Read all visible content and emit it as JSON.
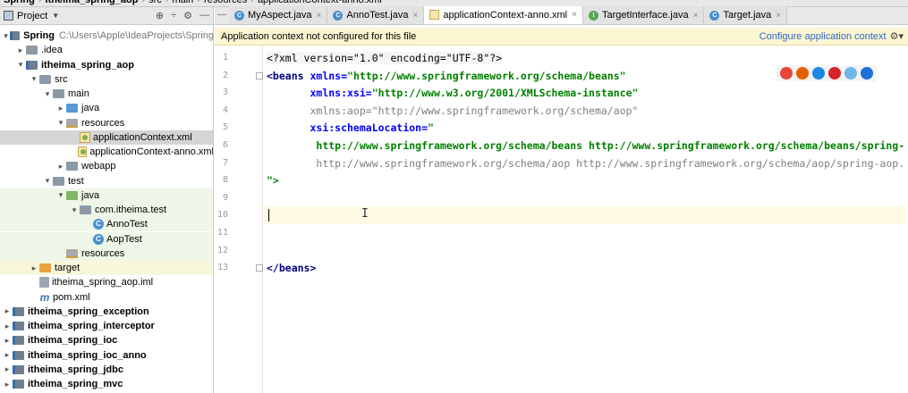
{
  "breadcrumb": [
    "Spring",
    "itheima_spring_aop",
    "src",
    "main",
    "resources",
    "applicationContext-anno.xml"
  ],
  "project_panel": {
    "title": "Project",
    "tools": [
      "⊕",
      "÷",
      "⚙",
      "—"
    ],
    "rows": [
      {
        "indent": 0,
        "arrow": "▾",
        "icon": "module",
        "label": "Spring",
        "bold": true,
        "hint": "C:\\Users\\Apple\\IdeaProjects\\Spring"
      },
      {
        "indent": 1,
        "arrow": "▸",
        "icon": "folder",
        "label": ".idea"
      },
      {
        "indent": 1,
        "arrow": "▾",
        "icon": "module",
        "label": "itheima_spring_aop",
        "bold": true
      },
      {
        "indent": 2,
        "arrow": "▾",
        "icon": "folder",
        "label": "src"
      },
      {
        "indent": 3,
        "arrow": "▾",
        "icon": "folder",
        "label": "main"
      },
      {
        "indent": 4,
        "arrow": "▸",
        "icon": "folder-blue",
        "label": "java"
      },
      {
        "indent": 4,
        "arrow": "▾",
        "icon": "folder-res",
        "label": "resources"
      },
      {
        "indent": 5,
        "arrow": "",
        "icon": "xml",
        "label": "applicationContext.xml",
        "selected": true
      },
      {
        "indent": 5,
        "arrow": "",
        "icon": "xml",
        "label": "applicationContext-anno.xml"
      },
      {
        "indent": 4,
        "arrow": "▸",
        "icon": "folder",
        "label": "webapp"
      },
      {
        "indent": 3,
        "arrow": "▾",
        "icon": "folder",
        "label": "test"
      },
      {
        "indent": 4,
        "arrow": "▾",
        "icon": "folder-green",
        "label": "java",
        "test": true
      },
      {
        "indent": 5,
        "arrow": "▾",
        "icon": "folder",
        "label": "com.itheima.test",
        "test": true
      },
      {
        "indent": 6,
        "arrow": "",
        "icon": "class",
        "label": "AnnoTest",
        "test": true
      },
      {
        "indent": 6,
        "arrow": "",
        "icon": "class",
        "label": "AopTest",
        "test": true
      },
      {
        "indent": 4,
        "arrow": "",
        "icon": "folder-res",
        "label": "resources",
        "test": true
      },
      {
        "indent": 2,
        "arrow": "▸",
        "icon": "folder-orange",
        "label": "target",
        "excluded": true
      },
      {
        "indent": 2,
        "arrow": "",
        "icon": "iml",
        "label": "itheima_spring_aop.iml"
      },
      {
        "indent": 2,
        "arrow": "",
        "icon": "maven",
        "label": "pom.xml"
      },
      {
        "indent": 0,
        "arrow": "▸",
        "icon": "module",
        "label": "itheima_spring_exception",
        "bold": true
      },
      {
        "indent": 0,
        "arrow": "▸",
        "icon": "module",
        "label": "itheima_spring_interceptor",
        "bold": true
      },
      {
        "indent": 0,
        "arrow": "▸",
        "icon": "module",
        "label": "itheima_spring_ioc",
        "bold": true
      },
      {
        "indent": 0,
        "arrow": "▸",
        "icon": "module",
        "label": "itheima_spring_ioc_anno",
        "bold": true
      },
      {
        "indent": 0,
        "arrow": "▸",
        "icon": "module",
        "label": "itheima_spring_jdbc",
        "bold": true
      },
      {
        "indent": 0,
        "arrow": "▸",
        "icon": "module",
        "label": "itheima_spring_mvc",
        "bold": true
      }
    ]
  },
  "tabs": [
    {
      "label": "MyAspect.java",
      "icon": "c"
    },
    {
      "label": "AnnoTest.java",
      "icon": "c"
    },
    {
      "label": "applicationContext-anno.xml",
      "icon": "xml",
      "active": true
    },
    {
      "label": "TargetInterface.java",
      "icon": "i"
    },
    {
      "label": "Target.java",
      "icon": "c"
    }
  ],
  "notice": {
    "text": "Application context not configured for this file",
    "action": "Configure application context"
  },
  "editor": {
    "current_line": 10,
    "lines": [
      {
        "n": "1",
        "tokens": [
          [
            "decl",
            "<?xml version=\"1.0\" encoding=\"UTF-8\"?>"
          ]
        ]
      },
      {
        "n": "2",
        "tokens": [
          [
            "tag",
            "<beans "
          ],
          [
            "attr",
            "xmlns="
          ],
          [
            "str",
            "\"http://www.springframework.org/schema/beans\""
          ]
        ]
      },
      {
        "n": "3",
        "tokens": [
          [
            "plain",
            "       "
          ],
          [
            "attr",
            "xmlns:xsi="
          ],
          [
            "str",
            "\"http://www.w3.org/2001/XMLSchema-instance\""
          ]
        ]
      },
      {
        "n": "4",
        "tokens": [
          [
            "plain",
            "       "
          ],
          [
            "gray",
            "xmlns:aop=\"http://www.springframework.org/schema/aop\""
          ]
        ]
      },
      {
        "n": "5",
        "tokens": [
          [
            "plain",
            "       "
          ],
          [
            "attr",
            "xsi:schemaLocation="
          ],
          [
            "str",
            "\""
          ]
        ]
      },
      {
        "n": "6",
        "tokens": [
          [
            "plain",
            "        "
          ],
          [
            "str",
            "http://www.springframework.org/schema/beans http://www.springframework.org/schema/beans/spring-"
          ]
        ]
      },
      {
        "n": "7",
        "tokens": [
          [
            "plain",
            "        "
          ],
          [
            "gray",
            "http://www.springframework.org/schema/aop http://www.springframework.org/schema/aop/spring-aop."
          ]
        ]
      },
      {
        "n": "8",
        "tokens": [
          [
            "str",
            "\">"
          ]
        ]
      },
      {
        "n": "9",
        "tokens": []
      },
      {
        "n": "10",
        "tokens": []
      },
      {
        "n": "11",
        "tokens": []
      },
      {
        "n": "12",
        "tokens": []
      },
      {
        "n": "13",
        "tokens": [
          [
            "tag",
            "</beans>"
          ]
        ]
      }
    ]
  },
  "browser_icons": [
    {
      "name": "chrome-icon",
      "color": "#e8453c"
    },
    {
      "name": "firefox-icon",
      "color": "#e66000"
    },
    {
      "name": "safari-icon",
      "color": "#1e88e5"
    },
    {
      "name": "opera-icon",
      "color": "#d8232a"
    },
    {
      "name": "ie-icon",
      "color": "#6fb6e8"
    },
    {
      "name": "edge-icon",
      "color": "#1e6fd9"
    }
  ]
}
